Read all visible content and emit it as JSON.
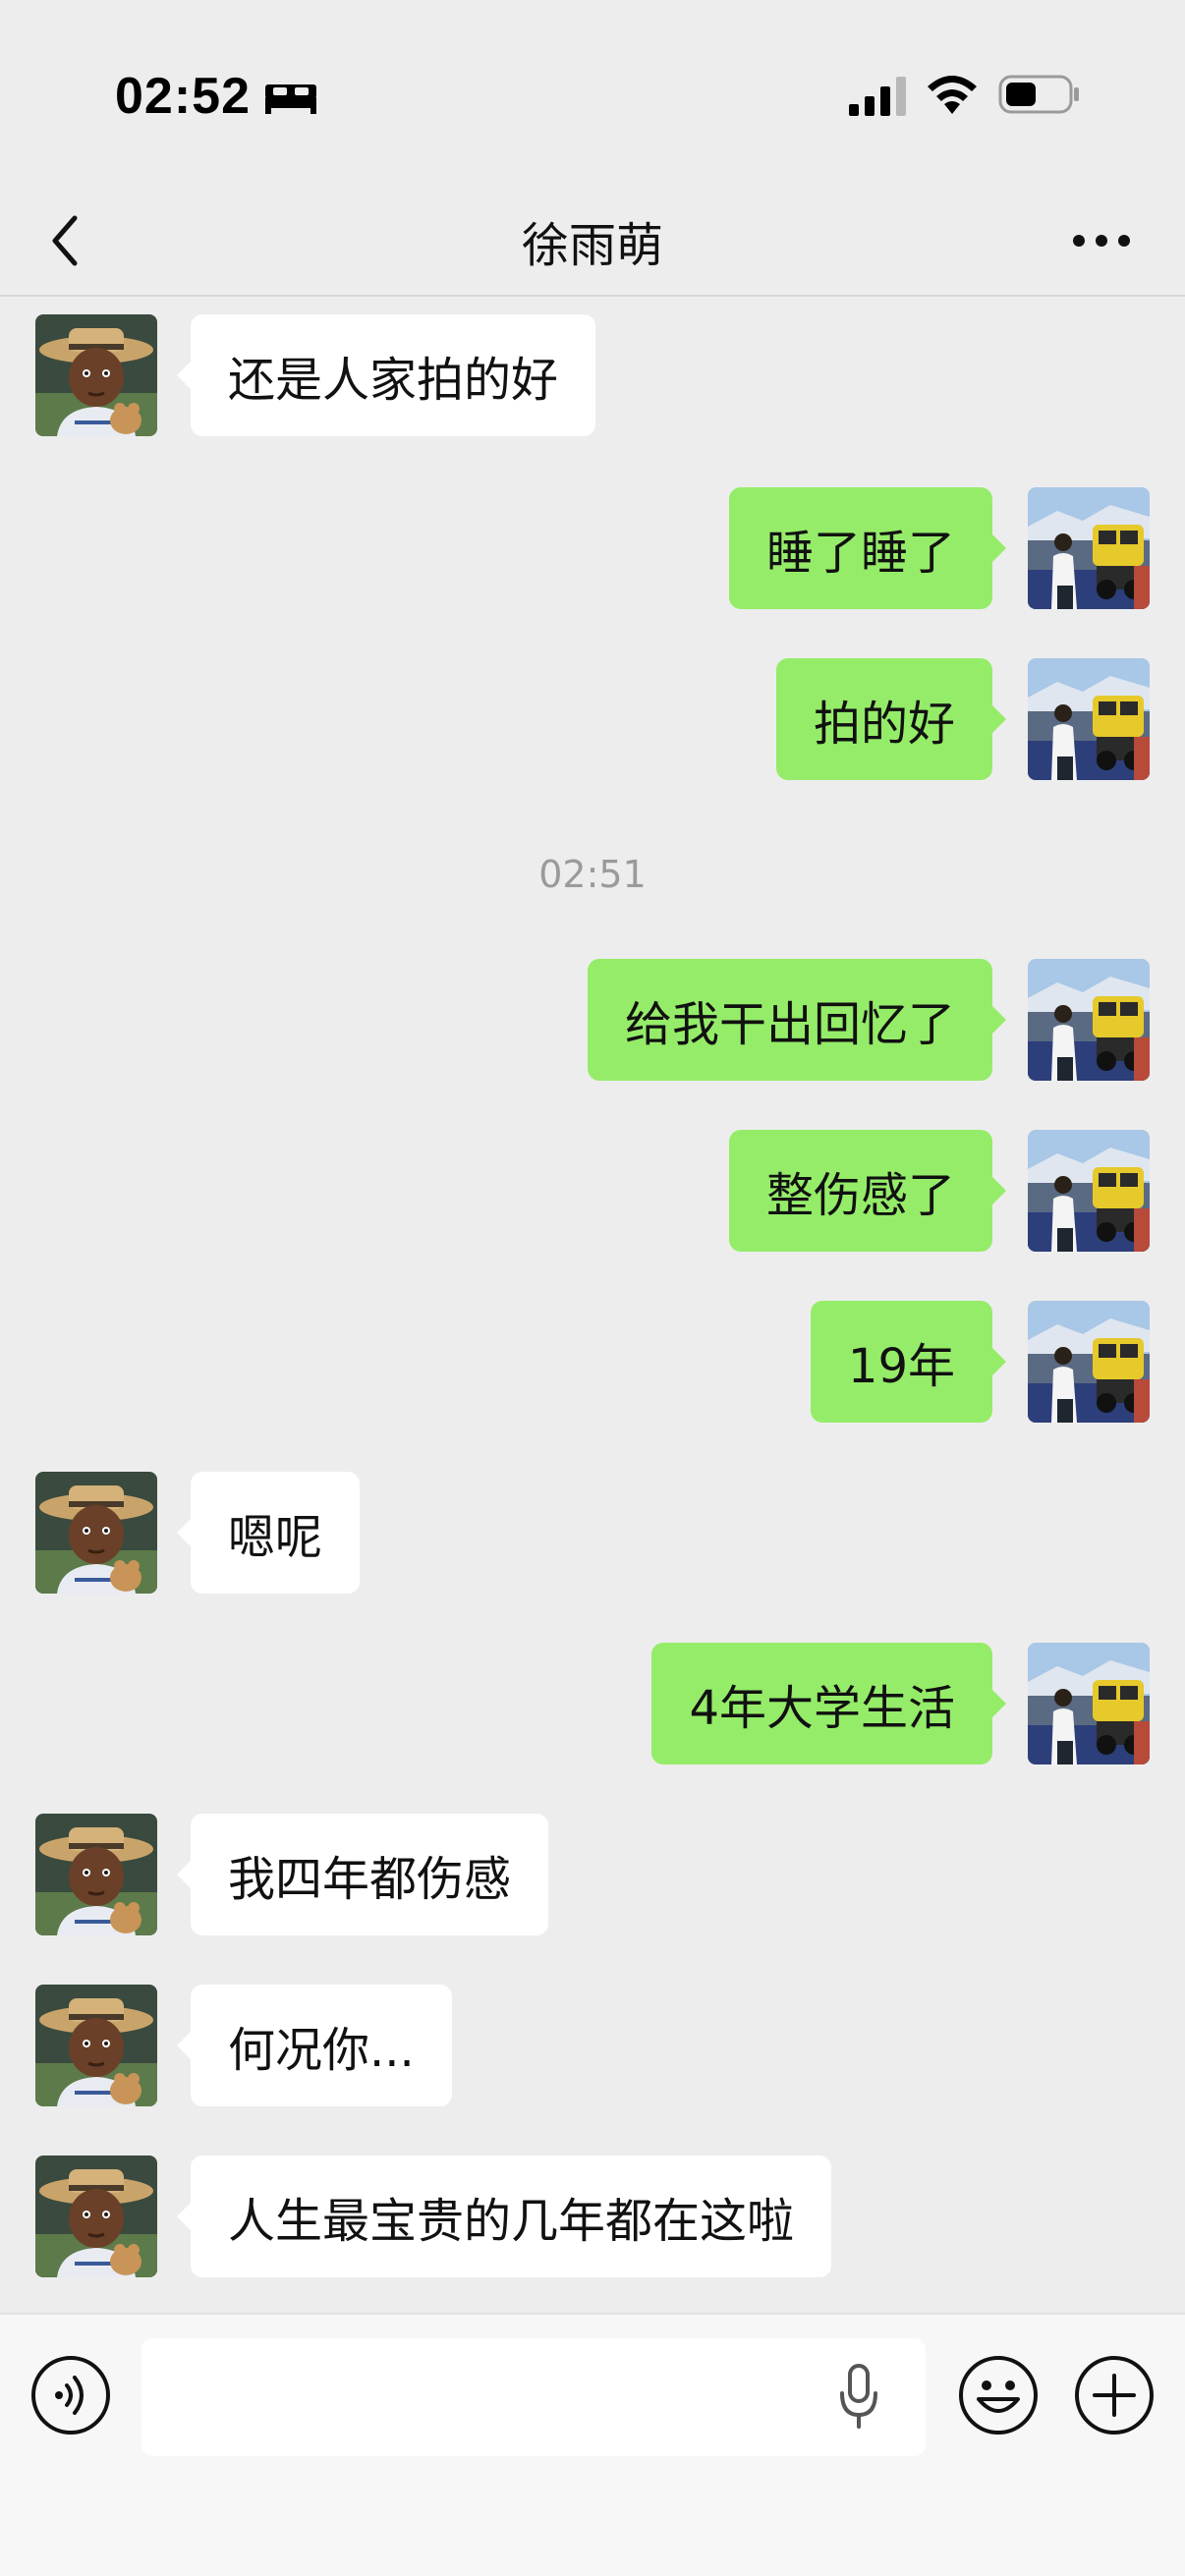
{
  "status_bar": {
    "time": "02:52",
    "icons": [
      "bed-icon",
      "cellular-signal-icon",
      "wifi-icon",
      "battery-icon"
    ]
  },
  "header": {
    "title": "徐雨萌",
    "back_icon": "chevron-left-icon",
    "more_icon": "more-dots-icon"
  },
  "colors": {
    "background": "#ededed",
    "sent_bubble": "#95ec69",
    "received_bubble": "#ffffff",
    "timestamp_text": "#9a9a9a"
  },
  "messages": [
    {
      "side": "received",
      "text": "还是人家拍的好"
    },
    {
      "side": "sent",
      "text": "睡了睡了"
    },
    {
      "side": "sent",
      "text": "拍的好"
    },
    {
      "type": "timestamp",
      "text": "02:51"
    },
    {
      "side": "sent",
      "text": "给我干出回忆了"
    },
    {
      "side": "sent",
      "text": "整伤感了"
    },
    {
      "side": "sent",
      "text": "19年"
    },
    {
      "side": "received",
      "text": "嗯呢"
    },
    {
      "side": "sent",
      "text": "4年大学生活"
    },
    {
      "side": "received",
      "text": "我四年都伤感"
    },
    {
      "side": "received",
      "text": "何况你..."
    },
    {
      "side": "received",
      "text": "人生最宝贵的几年都在这啦"
    }
  ],
  "input_bar": {
    "voice_icon": "voice-mode-icon",
    "text_value": "",
    "mic_icon": "microphone-icon",
    "emoji_icon": "emoji-icon",
    "plus_icon": "plus-icon"
  }
}
